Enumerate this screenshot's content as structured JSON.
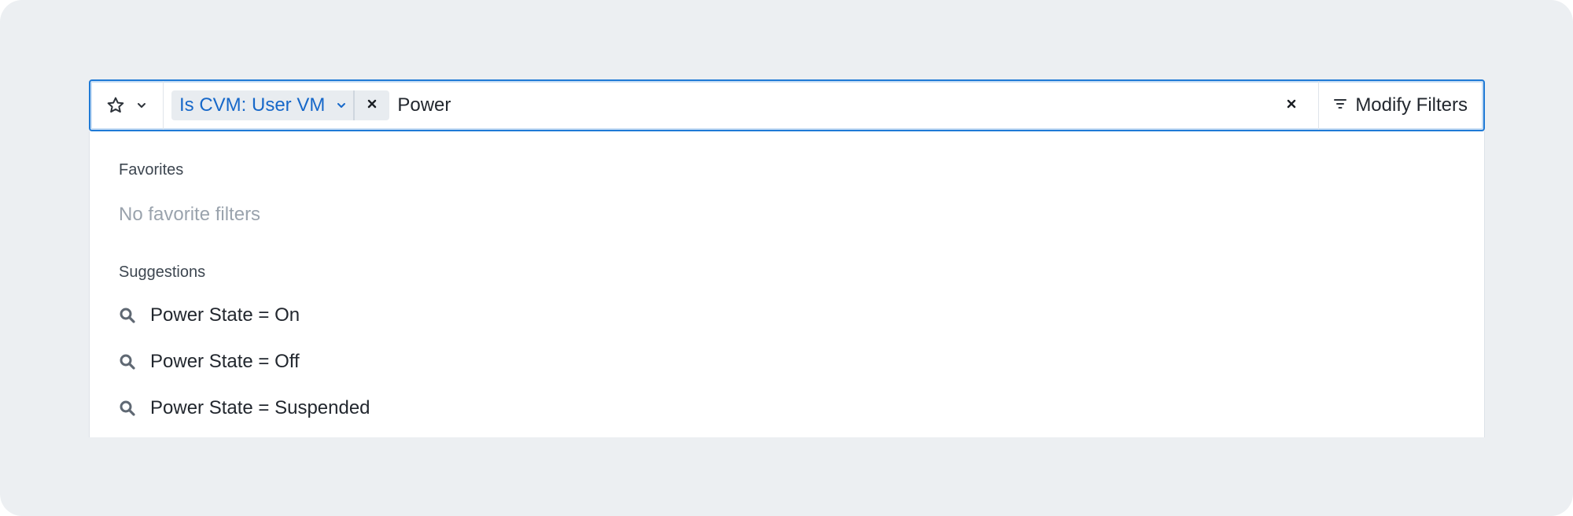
{
  "search_bar": {
    "favorites_toggle": {
      "icon": "star-icon",
      "chevron_icon": "chevron-down-icon"
    },
    "chip": {
      "label": "Is CVM: User VM",
      "chevron_icon": "chevron-down-icon",
      "remove_icon": "close-icon"
    },
    "query_value": "Power",
    "clear_icon": "close-icon",
    "modify_button": {
      "icon": "filter-icon",
      "label": "Modify Filters"
    }
  },
  "dropdown": {
    "favorites": {
      "title": "Favorites",
      "empty_text": "No favorite filters"
    },
    "suggestions": {
      "title": "Suggestions",
      "items": [
        {
          "icon": "search-icon",
          "label": "Power State = On"
        },
        {
          "icon": "search-icon",
          "label": "Power State = Off"
        },
        {
          "icon": "search-icon",
          "label": "Power State = Suspended"
        }
      ]
    }
  },
  "colors": {
    "background": "#eceff2",
    "accent": "#1f7ad6",
    "chip_text": "#1768c9",
    "chip_bg": "#e8ecf0",
    "muted_text": "#9aa3ad"
  }
}
